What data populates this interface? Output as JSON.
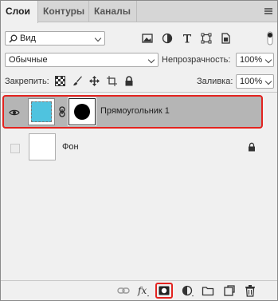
{
  "tabs": [
    {
      "label": "Слои"
    },
    {
      "label": "Контуры"
    },
    {
      "label": "Каналы"
    }
  ],
  "filter": {
    "kind_label": "Вид"
  },
  "blend": {
    "mode": "Обычные",
    "opacity_label": "Непрозрачность:",
    "opacity_value": "100%"
  },
  "lock": {
    "label": "Закрепить:",
    "fill_label": "Заливка:",
    "fill_value": "100%"
  },
  "layers": [
    {
      "name": "Прямоугольник 1",
      "visible": true,
      "selected": true,
      "thumb_color": "#4fc3df"
    },
    {
      "name": "Фон",
      "visible": false,
      "locked": true
    }
  ],
  "colors": {
    "accent": "#e3231f",
    "selected_row": "#b5b5b5",
    "panel": "#f0f0f0"
  }
}
